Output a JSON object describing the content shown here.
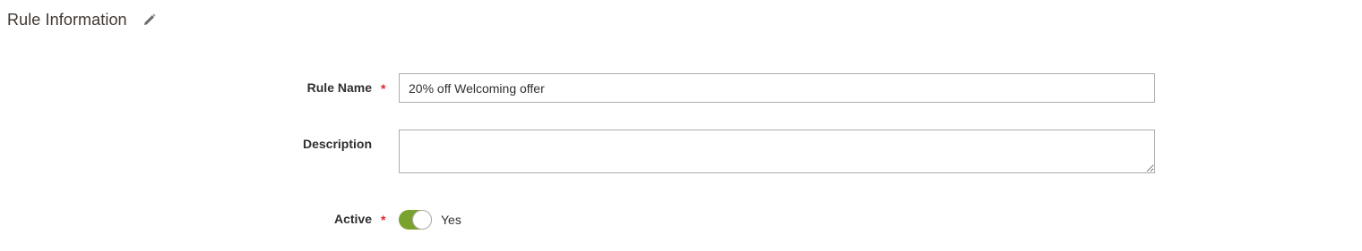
{
  "section": {
    "title": "Rule Information",
    "edit_icon": "pencil-icon"
  },
  "fields": {
    "rule_name": {
      "label": "Rule Name",
      "required_mark": "*",
      "value": "20% off Welcoming offer"
    },
    "description": {
      "label": "Description",
      "value": ""
    },
    "active": {
      "label": "Active",
      "required_mark": "*",
      "state_label": "Yes",
      "checked": true
    }
  },
  "colors": {
    "toggle_on": "#79a22e",
    "required": "#e22626",
    "input_border": "#adadad"
  }
}
